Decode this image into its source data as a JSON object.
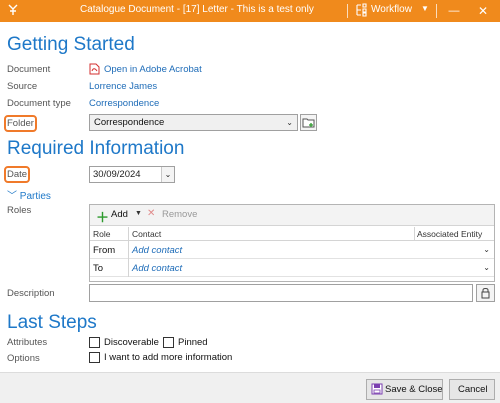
{
  "titlebar": {
    "title": "Catalogue Document - [17] Letter - This is a test only",
    "workflow_label": "Workflow",
    "accent": "#f08a1c"
  },
  "getting_started": {
    "heading": "Getting Started",
    "document_label": "Document",
    "document_value": "Open in Adobe Acrobat",
    "document_icon": "pdf-icon",
    "source_label": "Source",
    "source_value": "Lorrence James",
    "doctype_label": "Document type",
    "doctype_value": "Correspondence",
    "folder_label": "Folder",
    "folder_value": "Correspondence"
  },
  "required": {
    "heading": "Required Information",
    "date_label": "Date",
    "date_value": "30/09/2024",
    "parties_label": "Parties",
    "roles_label": "Roles",
    "toolbar": {
      "add_label": "Add",
      "remove_label": "Remove"
    },
    "table": {
      "columns": [
        "Role",
        "Contact",
        "Associated Entity"
      ],
      "rows": [
        {
          "role": "From",
          "contact": "Add contact"
        },
        {
          "role": "To",
          "contact": "Add contact"
        }
      ]
    },
    "description_label": "Description",
    "description_value": ""
  },
  "last_steps": {
    "heading": "Last Steps",
    "attributes_label": "Attributes",
    "discoverable_label": "Discoverable",
    "pinned_label": "Pinned",
    "options_label": "Options",
    "more_info_label": "I want to add more information"
  },
  "footer": {
    "save_label": "Save & Close",
    "cancel_label": "Cancel"
  },
  "colors": {
    "heading": "#1e78c8",
    "link": "#1e6cb8",
    "highlight": "#f07a2a"
  }
}
